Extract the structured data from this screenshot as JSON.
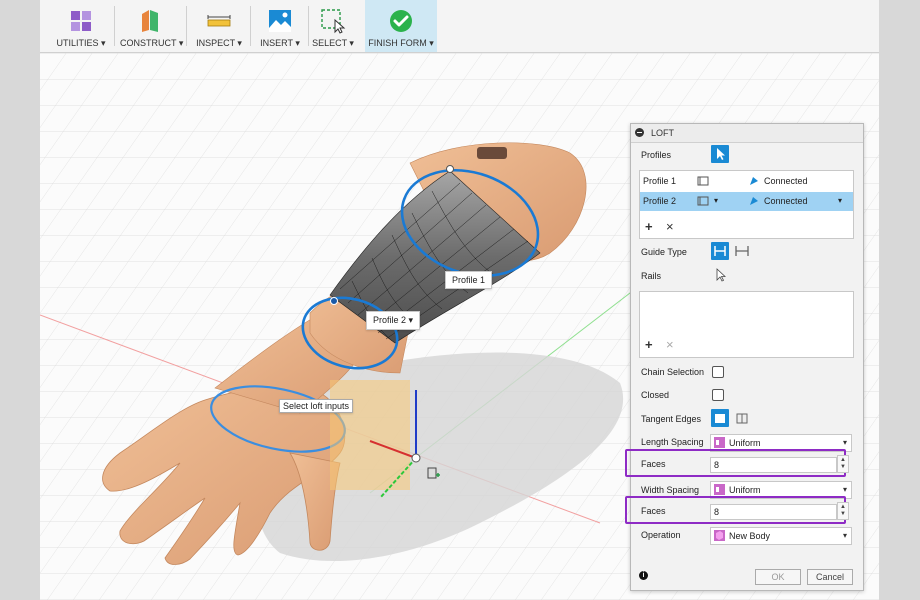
{
  "toolbar": {
    "groups": [
      {
        "label": "UTILITIES ▾",
        "icon": "utilities-icon"
      },
      {
        "label": "CONSTRUCT ▾",
        "icon": "construct-plane-icon"
      },
      {
        "label": "INSPECT ▾",
        "icon": "measure-ruler-icon"
      },
      {
        "label": "INSERT ▾",
        "icon": "insert-image-icon"
      },
      {
        "label": "SELECT ▾",
        "icon": "select-box-icon"
      },
      {
        "label": "FINISH FORM ▾",
        "icon": "checkmark-icon"
      }
    ]
  },
  "viewport": {
    "callouts": {
      "profile1": "Profile 1",
      "profile2": "Profile 2 ▾",
      "select_loft": "Select loft inputs"
    }
  },
  "loft": {
    "title": "LOFT",
    "profiles_label": "Profiles",
    "profiles": [
      {
        "name": "Profile 1",
        "continuity": "Connected",
        "selected": false
      },
      {
        "name": "Profile 2",
        "continuity": "Connected",
        "selected": true
      }
    ],
    "add_symbol": "+",
    "remove_symbol": "×",
    "guide_type_label": "Guide Type",
    "rails_label": "Rails",
    "chain_selection_label": "Chain Selection",
    "closed_label": "Closed",
    "tangent_edges_label": "Tangent Edges",
    "length_spacing_label": "Length Spacing",
    "length_spacing_value": "Uniform",
    "length_faces_label": "Faces",
    "length_faces_value": "8",
    "width_spacing_label": "Width Spacing",
    "width_spacing_value": "Uniform",
    "width_faces_label": "Faces",
    "width_faces_value": "8",
    "operation_label": "Operation",
    "operation_value": "New Body",
    "ok_label": "OK",
    "cancel_label": "Cancel",
    "info_symbol": "i"
  },
  "colors": {
    "accent_blue": "#1a8ad4",
    "selection_row": "#9fd2f3",
    "highlight_purple": "#8e2bc5",
    "finish_green": "#2bb24c"
  }
}
